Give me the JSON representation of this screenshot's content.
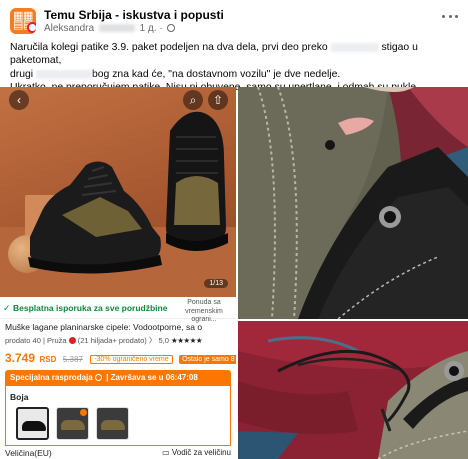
{
  "post": {
    "group_name": "Temu Srbija - iskustva i popusti",
    "author": "Aleksandra",
    "time": "1 д.",
    "text_line1_a": "Naručila kolegi patike 3.9. paket podeljen na dva dela, prvi deo preko",
    "text_line1_b": "stigao u paketomat,",
    "text_line2_a": "drugi",
    "text_line2_b": "bog zna kad će, \"na dostavnom vozilu\" je dve nedelje.",
    "text_line3": "Ukratko, ne preporučujem patike. Nisu ni obuvene, samo su upertlane, i odmah su pukle."
  },
  "product": {
    "photo_counter": "1/13",
    "shipping": "Besplatna isporuka za sve porudžbine",
    "shipping_note": "Ponuda sa vremenskim ograni...",
    "title": "Muške lagane planinarske cipele: Vodootporne, sa o",
    "stats_prefix": "prodato 40 | Pruža",
    "stats_suffix": "(21 hiljada+ prodato) 〉",
    "rating": "5,0",
    "stars": "★★★★★",
    "price": "3.749",
    "currency": "RSD",
    "old_price": "5.387",
    "discount": "-30% ograničeno vreme",
    "stock_left": "Ostalo je samo 8",
    "flash_label": "Specijalna rasprodaja",
    "flash_ends": "| Završava se u 06:47:08",
    "color_label": "Boja",
    "size_label": "Veličina(EU)",
    "size_guide": "Vodič za veličinu"
  },
  "colors": {
    "temu_orange": "#fb7701",
    "free_shipping_green": "#0a8a3a",
    "meta_gray": "#65676b"
  },
  "icons": [
    "temu-logo-icon",
    "more-options-icon",
    "globe-icon",
    "back-arrow-icon",
    "search-icon",
    "share-icon",
    "check-icon",
    "clock-icon",
    "ruler-icon"
  ]
}
